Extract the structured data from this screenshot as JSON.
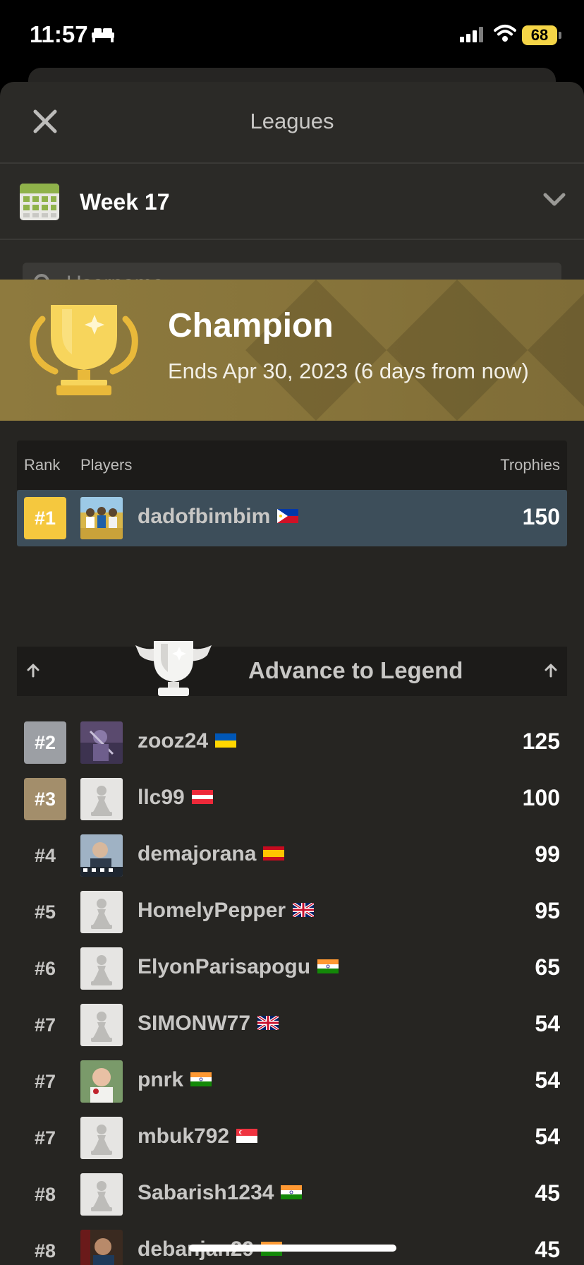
{
  "status": {
    "time": "11:57",
    "battery": "68"
  },
  "header": {
    "title": "Leagues"
  },
  "week": {
    "label": "Week 17"
  },
  "search": {
    "placeholder": "Username"
  },
  "banner": {
    "title": "Champion",
    "subtitle": "Ends Apr 30, 2023 (6 days from now)"
  },
  "table": {
    "rank_header": "Rank",
    "players_header": "Players",
    "trophies_header": "Trophies"
  },
  "advance": {
    "label": "Advance to Legend"
  },
  "leader": {
    "rank": "#1",
    "name": "dadofbimbim",
    "flag": "philippines-flag",
    "trophies": "150"
  },
  "players": [
    {
      "rank": "#2",
      "name": "zooz24",
      "flag": "ukraine-flag",
      "trophies": "125"
    },
    {
      "rank": "#3",
      "name": "llc99",
      "flag": "austria-flag",
      "trophies": "100"
    },
    {
      "rank": "#4",
      "name": "demajorana",
      "flag": "spain-flag",
      "trophies": "99"
    },
    {
      "rank": "#5",
      "name": "HomelyPepper",
      "flag": "uk-flag",
      "trophies": "95"
    },
    {
      "rank": "#6",
      "name": "ElyonParisapogu",
      "flag": "india-flag",
      "trophies": "65"
    },
    {
      "rank": "#7",
      "name": "SIMONW77",
      "flag": "uk-flag",
      "trophies": "54"
    },
    {
      "rank": "#7",
      "name": "pnrk",
      "flag": "india-flag",
      "trophies": "54"
    },
    {
      "rank": "#7",
      "name": "mbuk792",
      "flag": "singapore-flag",
      "trophies": "54"
    },
    {
      "rank": "#8",
      "name": "Sabarish1234",
      "flag": "india-flag",
      "trophies": "45"
    },
    {
      "rank": "#8",
      "name": "debanjan29",
      "flag": "india-flag",
      "trophies": "45"
    }
  ],
  "colors": {
    "gold": "#f5c83e",
    "silver": "#9c9fa4",
    "bronze": "#a38e6b",
    "highlight": "#3d4e5a",
    "banner": "#8e7a3e"
  }
}
